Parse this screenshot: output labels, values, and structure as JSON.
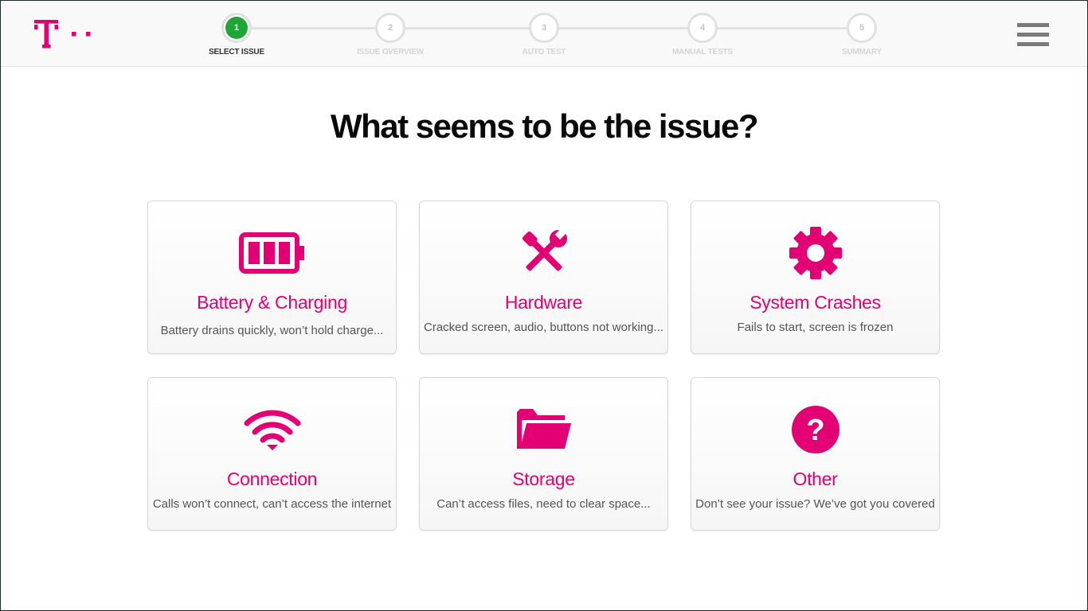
{
  "brand": {
    "logo_name": "t-mobile-logo",
    "magenta": "#e20074",
    "step_active_color": "#1fa637"
  },
  "stepper": {
    "steps": [
      {
        "number": "1",
        "label": "SELECT ISSUE",
        "active": true
      },
      {
        "number": "2",
        "label": "ISSUE OVERVIEW",
        "active": false
      },
      {
        "number": "3",
        "label": "AUTO TEST",
        "active": false
      },
      {
        "number": "4",
        "label": "MANUAL TESTS",
        "active": false
      },
      {
        "number": "5",
        "label": "SUMMARY",
        "active": false
      }
    ]
  },
  "menu": {
    "icon": "hamburger-menu-icon"
  },
  "page": {
    "title": "What seems to be the issue?"
  },
  "issues": [
    {
      "title": "Battery & Charging",
      "description": "Battery drains quickly, won’t hold charge...",
      "icon": "battery-icon"
    },
    {
      "title": "Hardware",
      "description": "Cracked screen, audio, buttons not working...",
      "icon": "tools-icon"
    },
    {
      "title": "System Crashes",
      "description": "Fails to start, screen is frozen",
      "icon": "gear-icon"
    },
    {
      "title": "Connection",
      "description": "Calls won’t connect, can’t access the internet",
      "icon": "wifi-icon"
    },
    {
      "title": "Storage",
      "description": "Can’t access files, need to clear space...",
      "icon": "folder-icon"
    },
    {
      "title": "Other",
      "description": "Don’t see your issue? We’ve got you covered",
      "icon": "question-icon"
    }
  ]
}
